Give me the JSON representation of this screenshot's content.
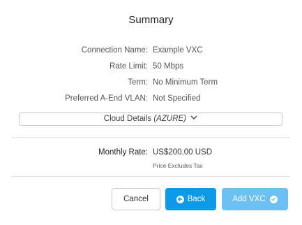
{
  "title": "Summary",
  "details": [
    {
      "label": "Connection Name:",
      "value": "Example VXC"
    },
    {
      "label": "Rate Limit:",
      "value": "50 Mbps"
    },
    {
      "label": "Term:",
      "value": "No Minimum Term"
    },
    {
      "label": "Preferred A-End VLAN:",
      "value": "Not Specified"
    }
  ],
  "cloud_details": {
    "label": "Cloud Details",
    "provider": "(AZURE)",
    "icon": "chevron-down-icon"
  },
  "monthly_rate": {
    "label": "Monthly Rate:",
    "value": "US$200.00 USD",
    "note": "Price Excludes Tax"
  },
  "buttons": {
    "cancel": "Cancel",
    "back": "Back",
    "back_icon": "arrow-left-circle-icon",
    "add": "Add VXC",
    "add_icon": "check-circle-icon"
  },
  "colors": {
    "primary": "#0c9ae8",
    "primary_light": "#6cc1f2",
    "border": "#c9c9c9"
  }
}
